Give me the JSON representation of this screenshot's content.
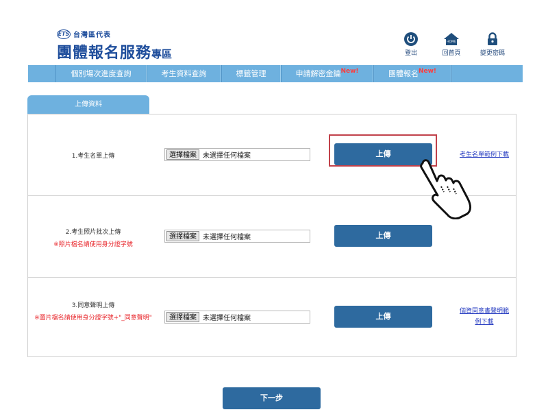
{
  "header": {
    "brand_badge": "ETS",
    "brand_sub": "台灣區代表",
    "title_main": "團體報名服務",
    "title_suffix": "專區"
  },
  "top_links": [
    {
      "label": "登出",
      "icon": "power-icon"
    },
    {
      "label": "回首頁",
      "icon": "home-icon",
      "icon_text": "HOME"
    },
    {
      "label": "變更密碼",
      "icon": "lock-icon"
    }
  ],
  "nav": {
    "items": [
      {
        "label": "個別場次進度查詢",
        "badge": ""
      },
      {
        "label": "考生資料查詢",
        "badge": ""
      },
      {
        "label": "標籤管理",
        "badge": ""
      },
      {
        "label": "申請解密金鑰",
        "badge": "New!"
      },
      {
        "label": "團體報名",
        "badge": "New!"
      },
      {
        "label": "",
        "badge": ""
      }
    ]
  },
  "tab": {
    "label": "上傳資料"
  },
  "rows": [
    {
      "label": "1.考生名單上傳",
      "note": "",
      "file_button": "選擇檔案",
      "file_status": "未選擇任何檔案",
      "upload_label": "上傳",
      "link": "考生名單範例下載"
    },
    {
      "label": "2.考生照片批次上傳",
      "note": "※照片檔名請使用身分證字號",
      "file_button": "選擇檔案",
      "file_status": "未選擇任何檔案",
      "upload_label": "上傳",
      "link": ""
    },
    {
      "label": "3.同意聲明上傳",
      "note": "※圖片檔名請使用身分證字號+\"_同意聲明\"",
      "file_button": "選擇檔案",
      "file_status": "未選擇任何檔案",
      "upload_label": "上傳",
      "link_line1": "個資同意書聲明範",
      "link_line2": "例下載"
    }
  ],
  "next_button": "下一步",
  "colors": {
    "brand": "#1f4e9c",
    "nav_bg": "#6eb1df",
    "button_bg": "#2e6a9f",
    "note": "#e8262b",
    "link": "#2a3fc2",
    "highlight": "#c1414a"
  }
}
